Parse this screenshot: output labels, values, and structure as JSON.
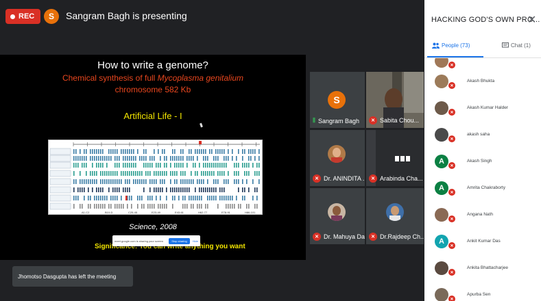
{
  "topbar": {
    "rec_label": "REC",
    "presenter_initial": "S",
    "presenting_text": "Sangram Bagh is presenting"
  },
  "slide": {
    "title": "How to write a genome?",
    "subtitle_1_before": "Chemical synthesis of full ",
    "subtitle_1_italic": "Mycoplasma genitalium",
    "subtitle_2": "chromosome 582 Kb",
    "artificial_life": "Artificial Life - I",
    "science_ref": "Science, 2008",
    "significance": "Significance: You can write anything you want",
    "map_axis_labels": [
      "A1-C2",
      "B10-D",
      "C25-45",
      "E23-49",
      "E43-61",
      "H62-77",
      "E78-91",
      "H86-101"
    ],
    "share_bar": {
      "text": "meet.google.com is sharing your screen",
      "stop_label": "Stop sharing",
      "hide_label": "Hide"
    }
  },
  "tiles": [
    {
      "name": "Sangram Bagh",
      "initial": "S"
    },
    {
      "name": "Sabita Chou..."
    },
    {
      "name": "Dr. ANINDITA ..."
    },
    {
      "name": "Arabinda Cha..."
    },
    {
      "name": "Dr. Mahuya Das"
    },
    {
      "name": "Dr.Rajdeep Ch..."
    }
  ],
  "toast": {
    "text": "Jhomotso Dasgupta has left the meeting"
  },
  "panel": {
    "title": "HACKING GOD'S OWN PRO...",
    "tab_people": "People (73)",
    "tab_chat": "Chat (1)",
    "participants": [
      {
        "name": "Akash Bhukta",
        "initial": "",
        "color": "#9c7b5a"
      },
      {
        "name": "Akash Kumar Halder",
        "initial": "",
        "color": "#6d5a4a"
      },
      {
        "name": "akash saha",
        "initial": "",
        "color": "#4a4a4a"
      },
      {
        "name": "Akash Singh",
        "initial": "A",
        "color": "#0b8043"
      },
      {
        "name": "Amrita Chakraborty",
        "initial": "A",
        "color": "#0b8043"
      },
      {
        "name": "Angana Nath",
        "initial": "",
        "color": "#8a6a55"
      },
      {
        "name": "Ankit Kumar Das",
        "initial": "A",
        "color": "#12a4af"
      },
      {
        "name": "Ankita Bhattacharjee",
        "initial": "",
        "color": "#5a4a40"
      },
      {
        "name": "Apurba Sen",
        "initial": "",
        "color": "#7a6a5a"
      }
    ]
  }
}
